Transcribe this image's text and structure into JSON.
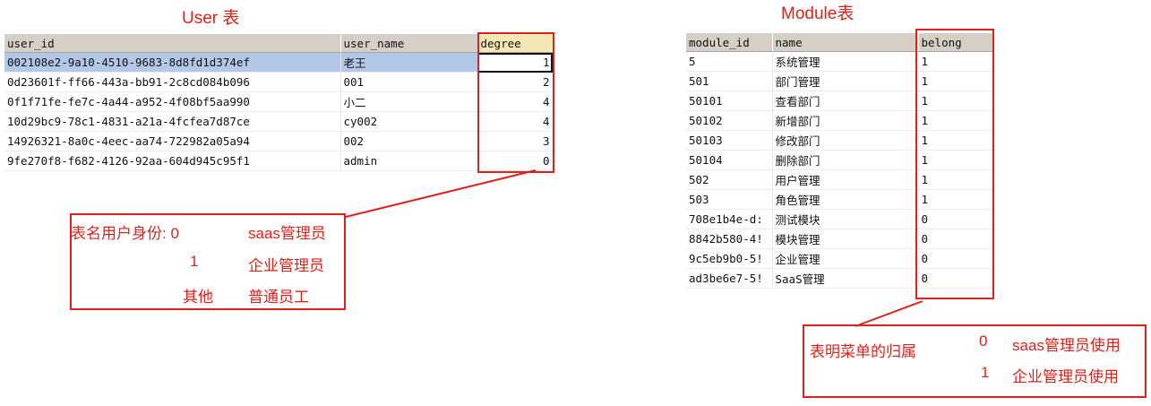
{
  "user_section": {
    "title": "User 表",
    "columns": [
      "user_id",
      "user_name",
      "degree"
    ],
    "rows": [
      {
        "user_id": "002108e2-9a10-4510-9683-8d8fd1d374ef",
        "user_name": "老王",
        "degree": "1"
      },
      {
        "user_id": "0d23601f-ff66-443a-bb91-2c8cd084b096",
        "user_name": "001",
        "degree": "2"
      },
      {
        "user_id": "0f1f71fe-fe7c-4a44-a952-4f08bf5aa990",
        "user_name": "小二",
        "degree": "4"
      },
      {
        "user_id": "10d29bc9-78c1-4831-a21a-4fcfea7d87ce",
        "user_name": "cy002",
        "degree": "4"
      },
      {
        "user_id": "14926321-8a0c-4eec-aa74-722982a05a94",
        "user_name": "002",
        "degree": "3"
      },
      {
        "user_id": "9fe270f8-f682-4126-92aa-604d945c95f1",
        "user_name": "admin",
        "degree": "0"
      }
    ],
    "note": {
      "prefix": "表名用户身份: 0",
      "line1_label": "saas管理员",
      "line2_code": "1",
      "line2_label": "企业管理员",
      "line3_code": "其他",
      "line3_label": "普通员工"
    }
  },
  "module_section": {
    "title": "Module表",
    "columns": [
      "module_id",
      "name",
      "belong"
    ],
    "rows": [
      {
        "module_id": "5",
        "name": "系统管理",
        "belong": "1"
      },
      {
        "module_id": "501",
        "name": "部门管理",
        "belong": "1"
      },
      {
        "module_id": "50101",
        "name": "查看部门",
        "belong": "1"
      },
      {
        "module_id": "50102",
        "name": "新增部门",
        "belong": "1"
      },
      {
        "module_id": "50103",
        "name": "修改部门",
        "belong": "1"
      },
      {
        "module_id": "50104",
        "name": "删除部门",
        "belong": "1"
      },
      {
        "module_id": "502",
        "name": "用户管理",
        "belong": "1"
      },
      {
        "module_id": "503",
        "name": "角色管理",
        "belong": "1"
      },
      {
        "module_id": "708e1b4e-d:",
        "name": "测试模块",
        "belong": "0"
      },
      {
        "module_id": "8842b580-4!",
        "name": "模块管理",
        "belong": "0"
      },
      {
        "module_id": "9c5eb9b0-5!",
        "name": "企业管理",
        "belong": "0"
      },
      {
        "module_id": "ad3be6e7-5!",
        "name": "SaaS管理",
        "belong": "0"
      }
    ],
    "note": {
      "label": "表明菜单的归属",
      "line1_code": "0",
      "line1_label": "saas管理员使用",
      "line2_code": "1",
      "line2_label": "企业管理员使用"
    }
  },
  "colors": {
    "annotation_red": "#e0201b",
    "header_gray": "#d4d0c8",
    "selected_row_blue": "#b2c8e6",
    "highlight_header": "#f5e7b6"
  }
}
